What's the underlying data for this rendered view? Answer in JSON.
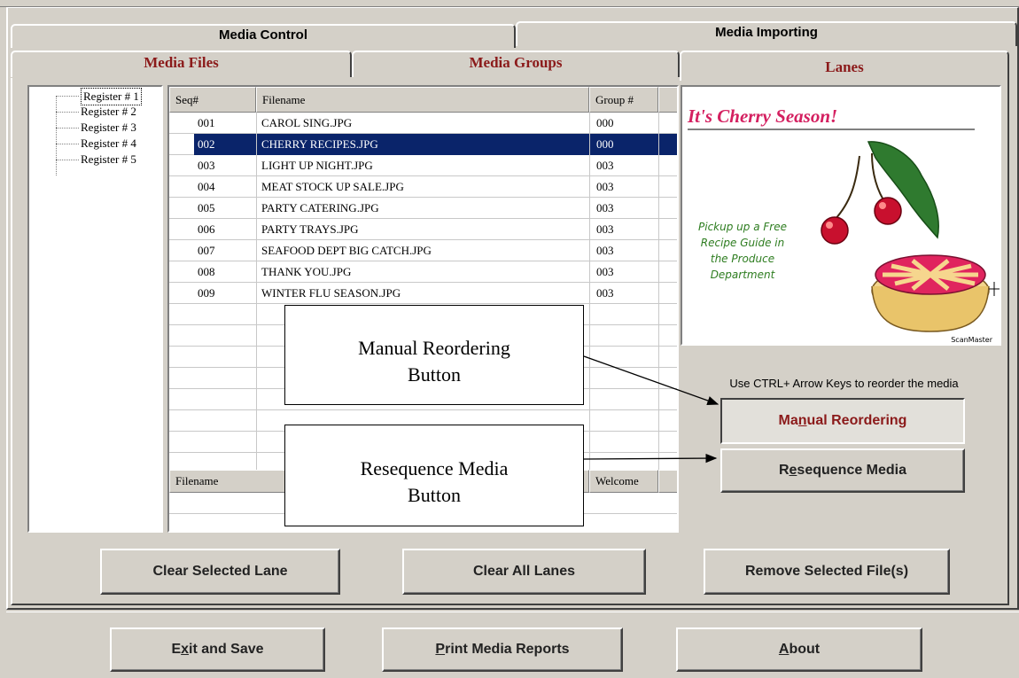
{
  "top_tabs": [
    "Media Control",
    "Media Importing"
  ],
  "sub_tabs": [
    "Media Files",
    "Media Groups",
    "Lanes"
  ],
  "registers": [
    "Register # 1",
    "Register # 2",
    "Register # 3",
    "Register # 4",
    "Register # 5"
  ],
  "media_table": {
    "headers": [
      "Seq#",
      "Filename",
      "Group #"
    ],
    "rows": [
      {
        "seq": "001",
        "filename": "CAROL SING.JPG",
        "group": "000"
      },
      {
        "seq": "002",
        "filename": "CHERRY RECIPES.JPG",
        "group": "000",
        "selected": true
      },
      {
        "seq": "003",
        "filename": "LIGHT UP NIGHT.JPG",
        "group": "003"
      },
      {
        "seq": "004",
        "filename": "MEAT STOCK UP SALE.JPG",
        "group": "003"
      },
      {
        "seq": "005",
        "filename": "PARTY CATERING.JPG",
        "group": "003"
      },
      {
        "seq": "006",
        "filename": "PARTY TRAYS.JPG",
        "group": "003"
      },
      {
        "seq": "007",
        "filename": "SEAFOOD DEPT BIG CATCH.JPG",
        "group": "003"
      },
      {
        "seq": "008",
        "filename": "THANK YOU.JPG",
        "group": "003"
      },
      {
        "seq": "009",
        "filename": "WINTER FLU SEASON.JPG",
        "group": "003"
      }
    ]
  },
  "lower_table": {
    "headers": [
      "Filename",
      "Welcome"
    ]
  },
  "preview": {
    "title": "It's Cherry Season!",
    "caption": [
      "Pickup up a Free",
      "Recipe Guide in",
      "the Produce",
      "Department"
    ],
    "brand": "ScanMaster"
  },
  "reorder_hint": "Use CTRL+ Arrow Keys to reorder the media",
  "buttons": {
    "manual_reordering": {
      "pre": "Ma",
      "u": "n",
      "post": "ual Reordering"
    },
    "resequence_media": {
      "pre": "R",
      "u": "e",
      "post": "sequence Media"
    },
    "clear_selected_lane": "Clear Selected Lane",
    "clear_all_lanes": "Clear All Lanes",
    "remove_selected_files": "Remove Selected File(s)",
    "exit_and_save": {
      "pre": "E",
      "u": "x",
      "post": "it and Save"
    },
    "print_media_reports": {
      "pre": "",
      "u": "P",
      "post": "rint Media Reports"
    },
    "about": {
      "pre": "",
      "u": "A",
      "post": "bout"
    }
  },
  "callouts": {
    "manual": [
      "Manual Reordering",
      "Button"
    ],
    "resequence": [
      "Resequence Media",
      "Button"
    ]
  },
  "colors": {
    "tab_red": "#8b1a1a",
    "selection": "#0a246a",
    "face": "#d4d0c8"
  }
}
